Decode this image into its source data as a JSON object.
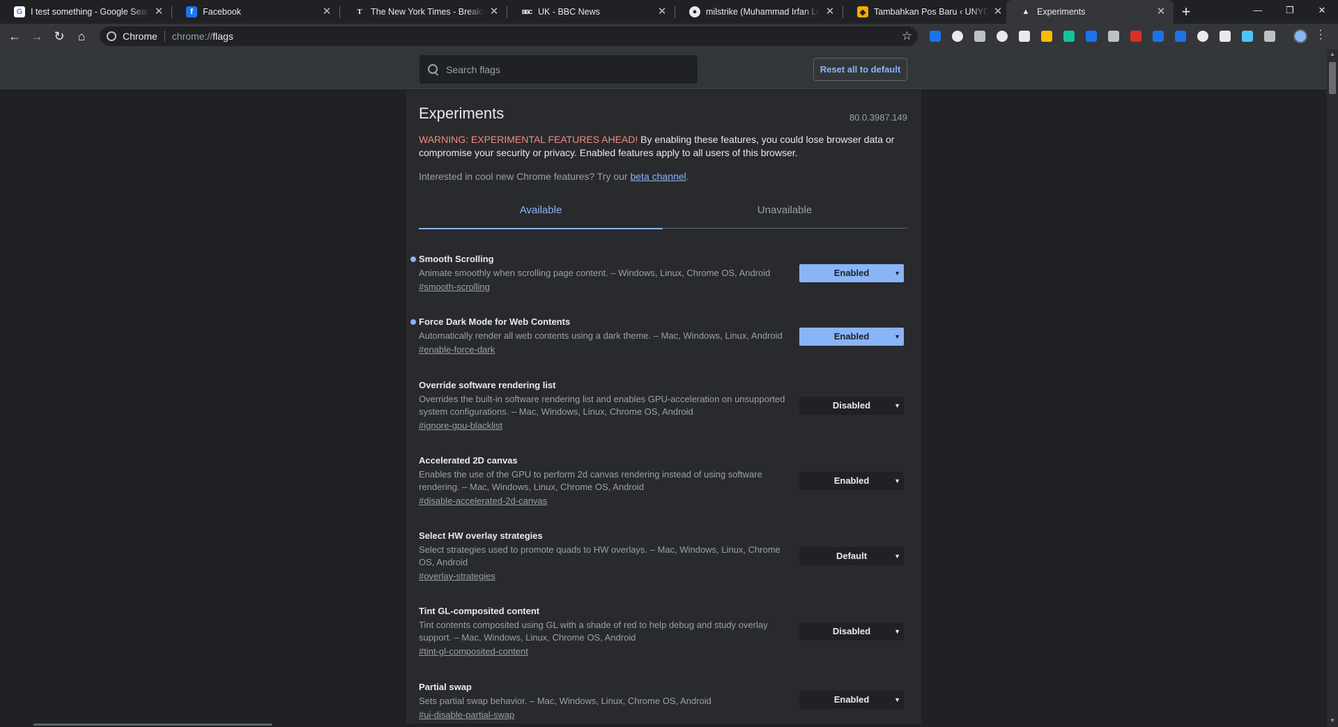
{
  "tabs": [
    {
      "title": "I test something - Google Search",
      "favicon": "google-favicon",
      "color": "#ffffff"
    },
    {
      "title": "Facebook",
      "favicon": "facebook-favicon",
      "color": "#1877f2"
    },
    {
      "title": "The New York Times - Breaking N",
      "favicon": "nytimes-favicon",
      "color": "#35363a"
    },
    {
      "title": "UK - BBC News",
      "favicon": "bbc-favicon",
      "color": "#35363a"
    },
    {
      "title": "milstrike (Muhammad Irfan Luthf",
      "favicon": "github-favicon",
      "color": "#35363a"
    },
    {
      "title": "Tambahkan Pos Baru ‹ UNYDevel",
      "favicon": "unydev-favicon",
      "color": "#f9ab00"
    },
    {
      "title": "Experiments",
      "favicon": "experiments-favicon",
      "color": "#35363a"
    }
  ],
  "omnibox": {
    "chip": "Chrome",
    "scheme": "chrome://",
    "path": "flags"
  },
  "search": {
    "placeholder": "Search flags"
  },
  "reset_label": "Reset all to default",
  "page": {
    "title": "Experiments",
    "version": "80.0.3987.149",
    "warning_lead": "WARNING: EXPERIMENTAL FEATURES AHEAD!",
    "warning_rest": " By enabling these features, you could lose browser data or compromise your security or privacy. Enabled features apply to all users of this browser.",
    "interested_pre": "Interested in cool new Chrome features? Try our ",
    "interested_link": "beta channel",
    "interested_post": "."
  },
  "section_tabs": {
    "available": "Available",
    "unavailable": "Unavailable"
  },
  "flags": [
    {
      "name": "Smooth Scrolling",
      "desc": "Animate smoothly when scrolling page content. – Windows, Linux, Chrome OS, Android",
      "hash": "#smooth-scrolling",
      "value": "Enabled",
      "modified": true
    },
    {
      "name": "Force Dark Mode for Web Contents",
      "desc": "Automatically render all web contents using a dark theme. – Mac, Windows, Linux, Android",
      "hash": "#enable-force-dark",
      "value": "Enabled",
      "modified": true
    },
    {
      "name": "Override software rendering list",
      "desc": "Overrides the built-in software rendering list and enables GPU-acceleration on unsupported system configurations. – Mac, Windows, Linux, Chrome OS, Android",
      "hash": "#ignore-gpu-blacklist",
      "value": "Disabled",
      "modified": false
    },
    {
      "name": "Accelerated 2D canvas",
      "desc": "Enables the use of the GPU to perform 2d canvas rendering instead of using software rendering. – Mac, Windows, Linux, Chrome OS, Android",
      "hash": "#disable-accelerated-2d-canvas",
      "value": "Enabled",
      "modified": false
    },
    {
      "name": "Select HW overlay strategies",
      "desc": "Select strategies used to promote quads to HW overlays. – Mac, Windows, Linux, Chrome OS, Android",
      "hash": "#overlay-strategies",
      "value": "Default",
      "modified": false
    },
    {
      "name": "Tint GL-composited content",
      "desc": "Tint contents composited using GL with a shade of red to help debug and study overlay support. – Mac, Windows, Linux, Chrome OS, Android",
      "hash": "#tint-gl-composited-content",
      "value": "Disabled",
      "modified": false
    },
    {
      "name": "Partial swap",
      "desc": "Sets partial swap behavior. – Mac, Windows, Linux, Chrome OS, Android",
      "hash": "#ui-disable-partial-swap",
      "value": "Enabled",
      "modified": false
    }
  ],
  "extension_icons": [
    "new-badge-extension-icon",
    "circle-extension-icon",
    "skype-extension-icon",
    "o-extension-icon",
    "notes-extension-icon",
    "chart-extension-icon",
    "grammarly-extension-icon",
    "k-extension-icon",
    "line-extension-icon",
    "adblock-extension-icon",
    "shield-extension-icon",
    "download-extension-icon",
    "spy-extension-icon",
    "puzzle-extension-icon",
    "screenshot-extension-icon",
    "audio-extension-icon"
  ],
  "colors": {
    "accent": "#8ab4f8",
    "warning": "#f28b82",
    "background": "#202124",
    "panel": "#292a2d"
  }
}
